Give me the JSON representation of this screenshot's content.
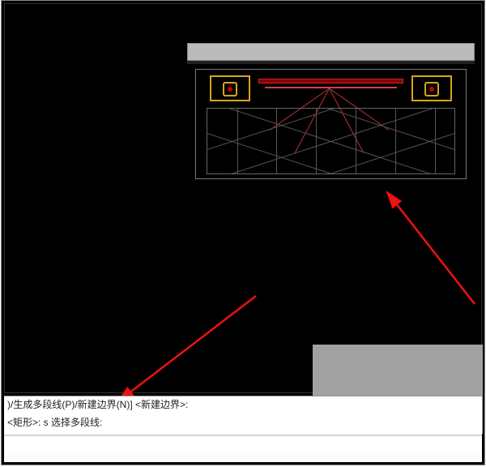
{
  "command": {
    "history_line1": ")/生成多段线(P)/新建边界(N)] <新建边界>:",
    "history_line2": "<矩形>: s 选择多段线:",
    "input_value": ""
  },
  "drawing": {
    "annotation_symbol_left": "red-circle-icon",
    "annotation_symbol_right": "red-circle-icon"
  }
}
